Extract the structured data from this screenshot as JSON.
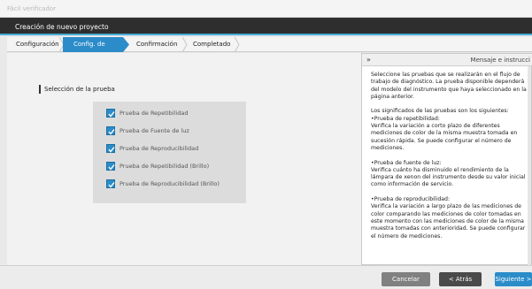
{
  "window": {
    "title": "Fácil verificador"
  },
  "header": {
    "title": "Creación de nuevo proyecto"
  },
  "steps": [
    {
      "label": "Configuración"
    },
    {
      "label": "Config. de prueba"
    },
    {
      "label": "Confirmación"
    },
    {
      "label": "Completado"
    }
  ],
  "main": {
    "section_label": "Selección de la prueba",
    "tests": [
      {
        "label": "Prueba de Repetibilidad",
        "checked": true
      },
      {
        "label": "Prueba de Fuente de luz",
        "checked": true
      },
      {
        "label": "Prueba de Reproducibilidad",
        "checked": true
      },
      {
        "label": "Prueba de Repetibilidad (Brillo)",
        "checked": true
      },
      {
        "label": "Prueba de Reproducibilidad (Brillo)",
        "checked": true
      }
    ]
  },
  "message_panel": {
    "collapse_symbol": "»",
    "title": "Mensaje e instrucci",
    "paragraphs": [
      "Seleccione las pruebas que se realizarán en el flujo de trabajo de diagnóstico. La prueba disponible dependerá del modelo del instrumento que haya seleccionado en la página anterior.",
      "Los significados de las pruebas son los siguientes:\n•Prueba de repetibilidad:\nVerifica la variación a corto plazo de diferentes mediciones de color de la misma muestra tomada en sucesión rápida. Se puede configurar el número de mediciones.",
      "•Prueba de fuente de luz:\nVerifica cuánto ha disminuido el rendimiento de la lámpara de xenon del instrumento desde su valor inicial como información de servicio.",
      "•Prueba de reproducibilidad:\nVerifica la variación a largo plazo de las mediciones de color comparando las mediciones de color tomadas en este momento con las mediciones de color de la misma muestra tomadas con anterioridad. Se puede configurar el número de mediciones."
    ]
  },
  "footer": {
    "cancel": "Cancelar",
    "back": "< Atrás",
    "next": "Siguiente >"
  },
  "colors": {
    "accent": "#2b8cc9",
    "header_bg": "#2e2e2e",
    "panel_bg": "#f2f2f2"
  }
}
